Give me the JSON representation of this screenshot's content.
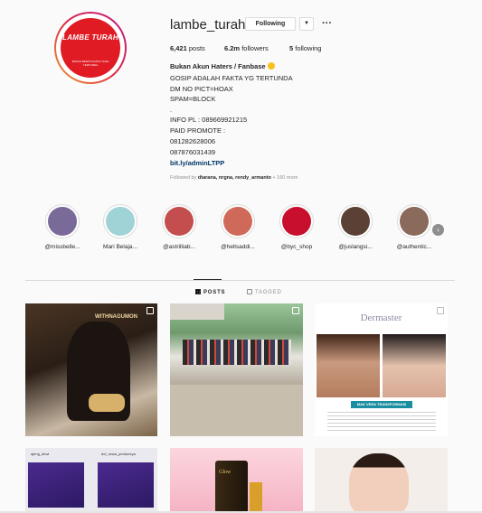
{
  "profile": {
    "avatar": {
      "title": "LAMBE TURAH",
      "subtitle": "BUKAN BERITA FAKTA YANG TERTUNDA"
    },
    "username": "lambe_turah",
    "follow_button": "Following",
    "caret": "▼",
    "more_icon": "···",
    "stats": {
      "posts_value": "6,421",
      "posts_label": "posts",
      "followers_value": "6.2m",
      "followers_label": "followers",
      "following_value": "5",
      "following_label": "following"
    },
    "bio": {
      "name": "Bukan Akun Haters / Fanbase",
      "lines": [
        "GOSIP ADALAH FAKTA YG TERTUNDA",
        "DM NO PICT=HOAX",
        "SPAM=BLOCK",
        ".",
        "INFO PL : 089669921215",
        "PAID PROMOTE :",
        "081282628006",
        "087876031439"
      ],
      "link": "bit.ly/adminLTPP"
    },
    "followed_by": {
      "prefix": "Followed by",
      "names": "dtarana, nrgna, rendy_armanto",
      "suffix": "+ 160 more"
    }
  },
  "highlights": [
    {
      "label": "@missbelle...",
      "color": "#7a6a9a"
    },
    {
      "label": "Mari Belaja...",
      "color": "#9fd3d6"
    },
    {
      "label": "@astrilliab...",
      "color": "#c44e4e"
    },
    {
      "label": "@hellsaddi...",
      "color": "#cf6a5a"
    },
    {
      "label": "@byc_shop",
      "color": "#c8102e"
    },
    {
      "label": "@juslangsi...",
      "color": "#5a4035"
    },
    {
      "label": "@authentic...",
      "color": "#8a6a5a"
    }
  ],
  "tabs": {
    "posts": "POSTS",
    "tagged": "TAGGED"
  },
  "posts": {
    "p1": {
      "caption": "WITHNAGUMON"
    },
    "p3": {
      "brand": "Dermaster",
      "bar": "MAK VERA TRANSFORMASI"
    },
    "p4": {
      "name_a": "ajeng_dewi",
      "name_b": "dol_rizwa_pentuneya"
    },
    "p5": {
      "text": "Glow"
    }
  },
  "colors": {
    "accent_link": "#003569",
    "muted": "#8e8e8e",
    "border": "#dbdbdb"
  }
}
